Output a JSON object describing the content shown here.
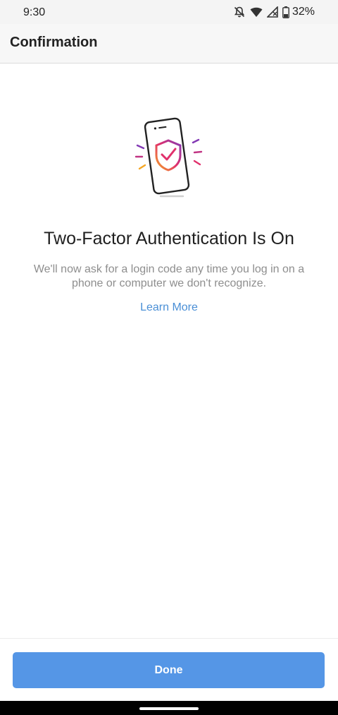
{
  "status_bar": {
    "time": "9:30",
    "icons": [
      "bell-off-icon",
      "wifi-icon",
      "cell-signal-icon",
      "battery-icon"
    ],
    "battery_text": "32%"
  },
  "app_bar": {
    "title": "Confirmation"
  },
  "illustration": {
    "icon": "phone-shield-check-icon"
  },
  "content": {
    "headline": "Two-Factor Authentication Is On",
    "description": "We'll now ask for a login code any time you log in on a phone or computer we don't recognize.",
    "learn_more": "Learn More"
  },
  "footer": {
    "done_label": "Done"
  },
  "colors": {
    "primary_button": "#5596e6",
    "link": "#4a8fd6",
    "muted_text": "#8e8e8e"
  }
}
